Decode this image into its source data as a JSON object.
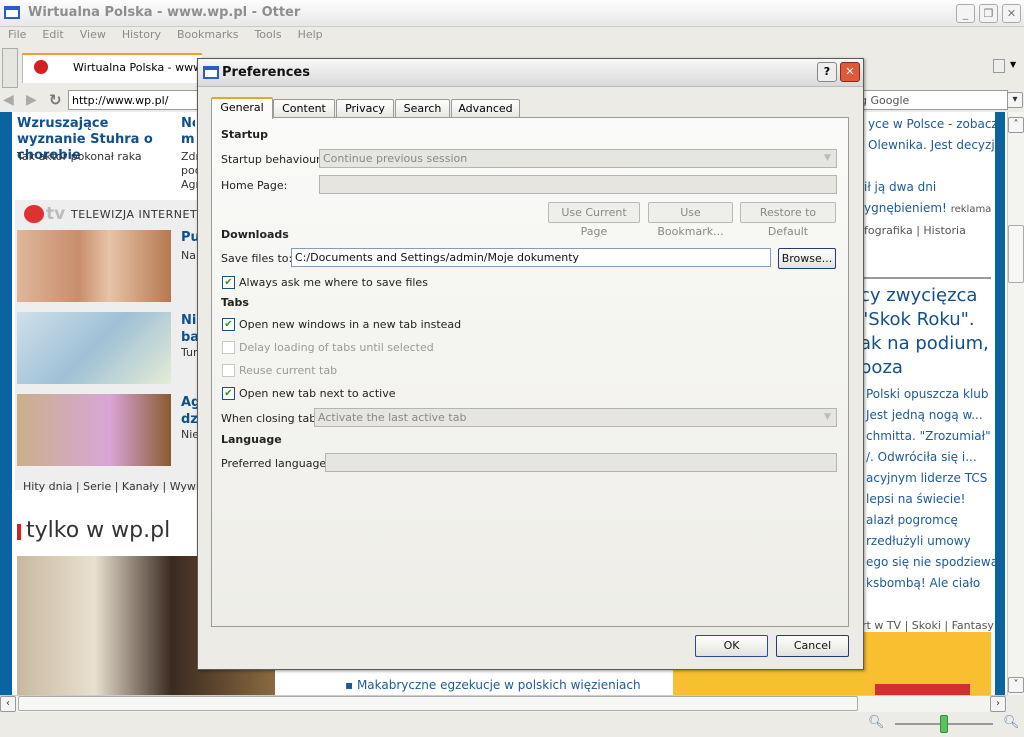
{
  "window": {
    "title": "Wirtualna Polska - www.wp.pl - Otter"
  },
  "menu": [
    "File",
    "Edit",
    "View",
    "History",
    "Bookmarks",
    "Tools",
    "Help"
  ],
  "browser_tab": {
    "label": "Wirtualna Polska - www.wp.pl"
  },
  "navbar": {
    "url": "http://www.wp.pl/",
    "search_placeholder": "g Google"
  },
  "page": {
    "left": {
      "headline": "Wzruszające wyznanie Stuhra o chorobie",
      "subtitle": "Tak aktor pokonał raka",
      "col2_headline": "No mi",
      "col2_text": "Zdr pod Agr",
      "tv_label": "TELEWIZJA INTERNETO",
      "tv_items": [
        "Pu",
        "Nap",
        "Nie ba",
        "Tur",
        "Ag dz",
        "Nie"
      ],
      "tv_links": [
        "Hity dnia",
        "Serie",
        "Kanały",
        "Wywiad"
      ],
      "section": "tylko w wp.pl",
      "bottom_link": "Makabryczne egzekucje w polskich więzieniach"
    },
    "right": {
      "lines_top": [
        "yce w Polsce - zobacz",
        "Olewnika. Jest decyzja",
        "ił ją dwa dni",
        "ygnębieniem!"
      ],
      "ad_label": "reklama",
      "links_top": [
        "fografika",
        "Historia"
      ],
      "headline": [
        "cy zwycięzca",
        "\"Skok Roku\".",
        "ak na podium,",
        "poza"
      ],
      "lines": [
        "Polski opuszcza klub",
        "Jest jedną nogą w...",
        "chmitta. \"Zrozumiał\"",
        "/. Odwróciła się i...",
        "acyjnym liderze TCS",
        "lepsi na świecie!",
        "alazł pogromcę",
        "rzedłużyli umowy",
        "ego się nie spodziewał",
        "ksbombą! Ale ciało"
      ],
      "links_bottom": [
        "rt w TV",
        "Skoki",
        "Fantasy"
      ]
    }
  },
  "status": {
    "zoom_level": 0.5
  },
  "dialog": {
    "title": "Preferences",
    "tabs": [
      "General",
      "Content",
      "Privacy",
      "Search",
      "Advanced"
    ],
    "active_tab": "General",
    "startup": {
      "heading": "Startup",
      "behaviour_label": "Startup behaviour:",
      "behaviour_value": "Continue previous session",
      "home_label": "Home Page:",
      "home_value": "",
      "btn_current": "Use Current Page",
      "btn_bookmark": "Use Bookmark...",
      "btn_default": "Restore to Default"
    },
    "downloads": {
      "heading": "Downloads",
      "save_label": "Save files to:",
      "save_value": "C:/Documents and Settings/admin/Moje dokumenty",
      "browse": "Browse...",
      "always_ask": "Always ask me where to save files",
      "always_ask_checked": true
    },
    "tabs_section": {
      "heading": "Tabs",
      "open_new_windows": "Open new windows in a new tab instead",
      "delay_loading": "Delay loading of tabs until selected",
      "reuse_current": "Reuse current tab",
      "open_next": "Open new tab next to active",
      "closing_label": "When closing tab:",
      "closing_value": "Activate the last active tab"
    },
    "language": {
      "heading": "Language",
      "preferred_label": "Preferred language:",
      "preferred_value": ""
    },
    "ok": "OK",
    "cancel": "Cancel"
  }
}
